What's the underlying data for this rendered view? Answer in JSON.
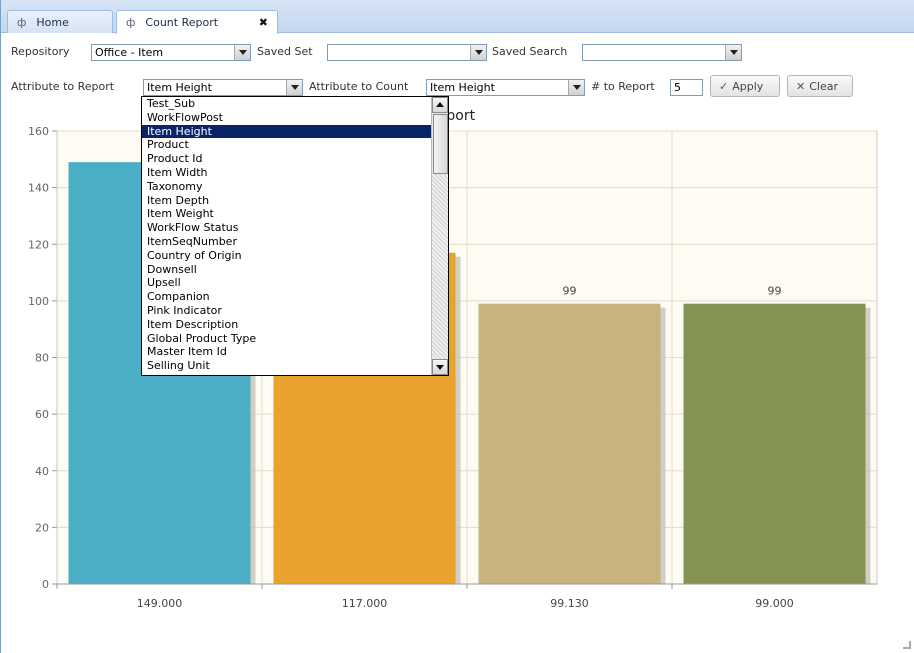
{
  "tabs": [
    {
      "label": "Home",
      "glyph": "ф"
    },
    {
      "label": "Count Report",
      "glyph": "ф",
      "close": "✖"
    }
  ],
  "toolbar1": {
    "repository_label": "Repository",
    "repository_value": "Office - Item",
    "saved_set_label": "Saved Set",
    "saved_set_value": "",
    "saved_search_label": "Saved Search",
    "saved_search_value": ""
  },
  "toolbar2": {
    "attr_report_label": "Attribute to Report",
    "attr_report_value": "Item Height",
    "attr_count_label": "Attribute to Count",
    "attr_count_value": "Item Height",
    "num_report_label": "# to Report",
    "num_report_value": "5",
    "apply_label": "Apply",
    "clear_label": "Clear"
  },
  "dropdown": {
    "options": [
      "Test_Sub",
      "WorkFlowPost",
      "Item Height",
      "Product",
      "Product Id",
      "Item Width",
      "Taxonomy",
      "Item Depth",
      "Item Weight",
      "WorkFlow Status",
      "ItemSeqNumber",
      "Country of Origin",
      "Downsell",
      "Upsell",
      "Companion",
      "Pink Indicator",
      "Item Description",
      "Global Product Type",
      "Master Item Id",
      "Selling Unit"
    ],
    "selected": "Item Height"
  },
  "chart_data": {
    "type": "bar",
    "title": "unt Report",
    "categories": [
      "149.000",
      "117.000",
      "99.130",
      "99.000"
    ],
    "values": [
      149,
      117,
      99,
      99
    ],
    "data_labels": [
      "",
      "",
      "99",
      "99"
    ],
    "ylim": [
      0,
      160
    ],
    "yticks": [
      0,
      20,
      40,
      60,
      80,
      100,
      120,
      140,
      160
    ],
    "colors": [
      "#4aafc4",
      "#e9a22d",
      "#c8b27e",
      "#849253"
    ],
    "plot_background": "#fdfbf2",
    "grid": true
  }
}
